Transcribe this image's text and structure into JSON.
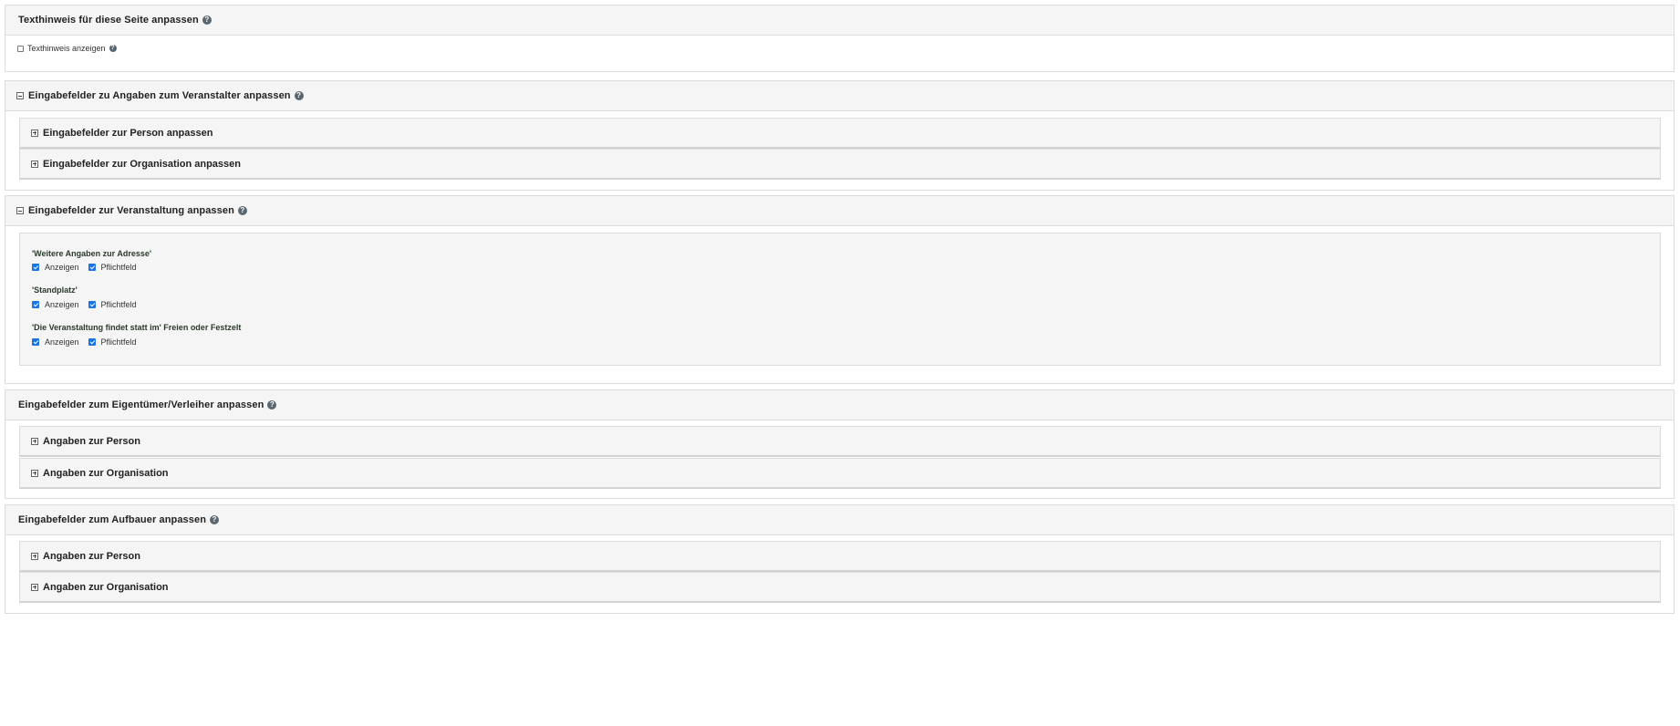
{
  "panels": {
    "text_hint": {
      "title": "Texthinweis für diese Seite anpassen",
      "checkbox_label": "Texthinweis anzeigen",
      "checkbox_checked": false
    },
    "organizer": {
      "title": "Eingabefelder zu Angaben zum Veranstalter anpassen",
      "sections": [
        "Eingabefelder zur Person anpassen",
        "Eingabefelder zur Organisation anpassen"
      ]
    },
    "event": {
      "title": "Eingabefelder zur Veranstaltung anpassen",
      "fields": [
        {
          "label": "'Weitere Angaben zur Adresse'",
          "show_label": "Anzeigen",
          "required_label": "Pflichtfeld",
          "show": true,
          "required": true
        },
        {
          "label": "'Standplatz'",
          "show_label": "Anzeigen",
          "required_label": "Pflichtfeld",
          "show": true,
          "required": true
        },
        {
          "label": "'Die Veranstaltung findet statt im' Freien oder Festzelt",
          "show_label": "Anzeigen",
          "required_label": "Pflichtfeld",
          "show": true,
          "required": true
        }
      ]
    },
    "owner": {
      "title": "Eingabefelder zum Eigentümer/Verleiher anpassen",
      "sections": [
        "Angaben zur Person",
        "Angaben zur Organisation"
      ]
    },
    "builder": {
      "title": "Eingabefelder zum Aufbauer anpassen",
      "sections": [
        "Angaben zur Person",
        "Angaben zur Organisation"
      ]
    }
  },
  "icons": {
    "help": "question-circle-icon",
    "collapse": "minus-square-icon",
    "expand": "plus-square-icon"
  },
  "colors": {
    "panel_header_bg": "#f5f5f5",
    "border": "#dcdcdc",
    "checkbox_checked": "#1a73e8"
  }
}
